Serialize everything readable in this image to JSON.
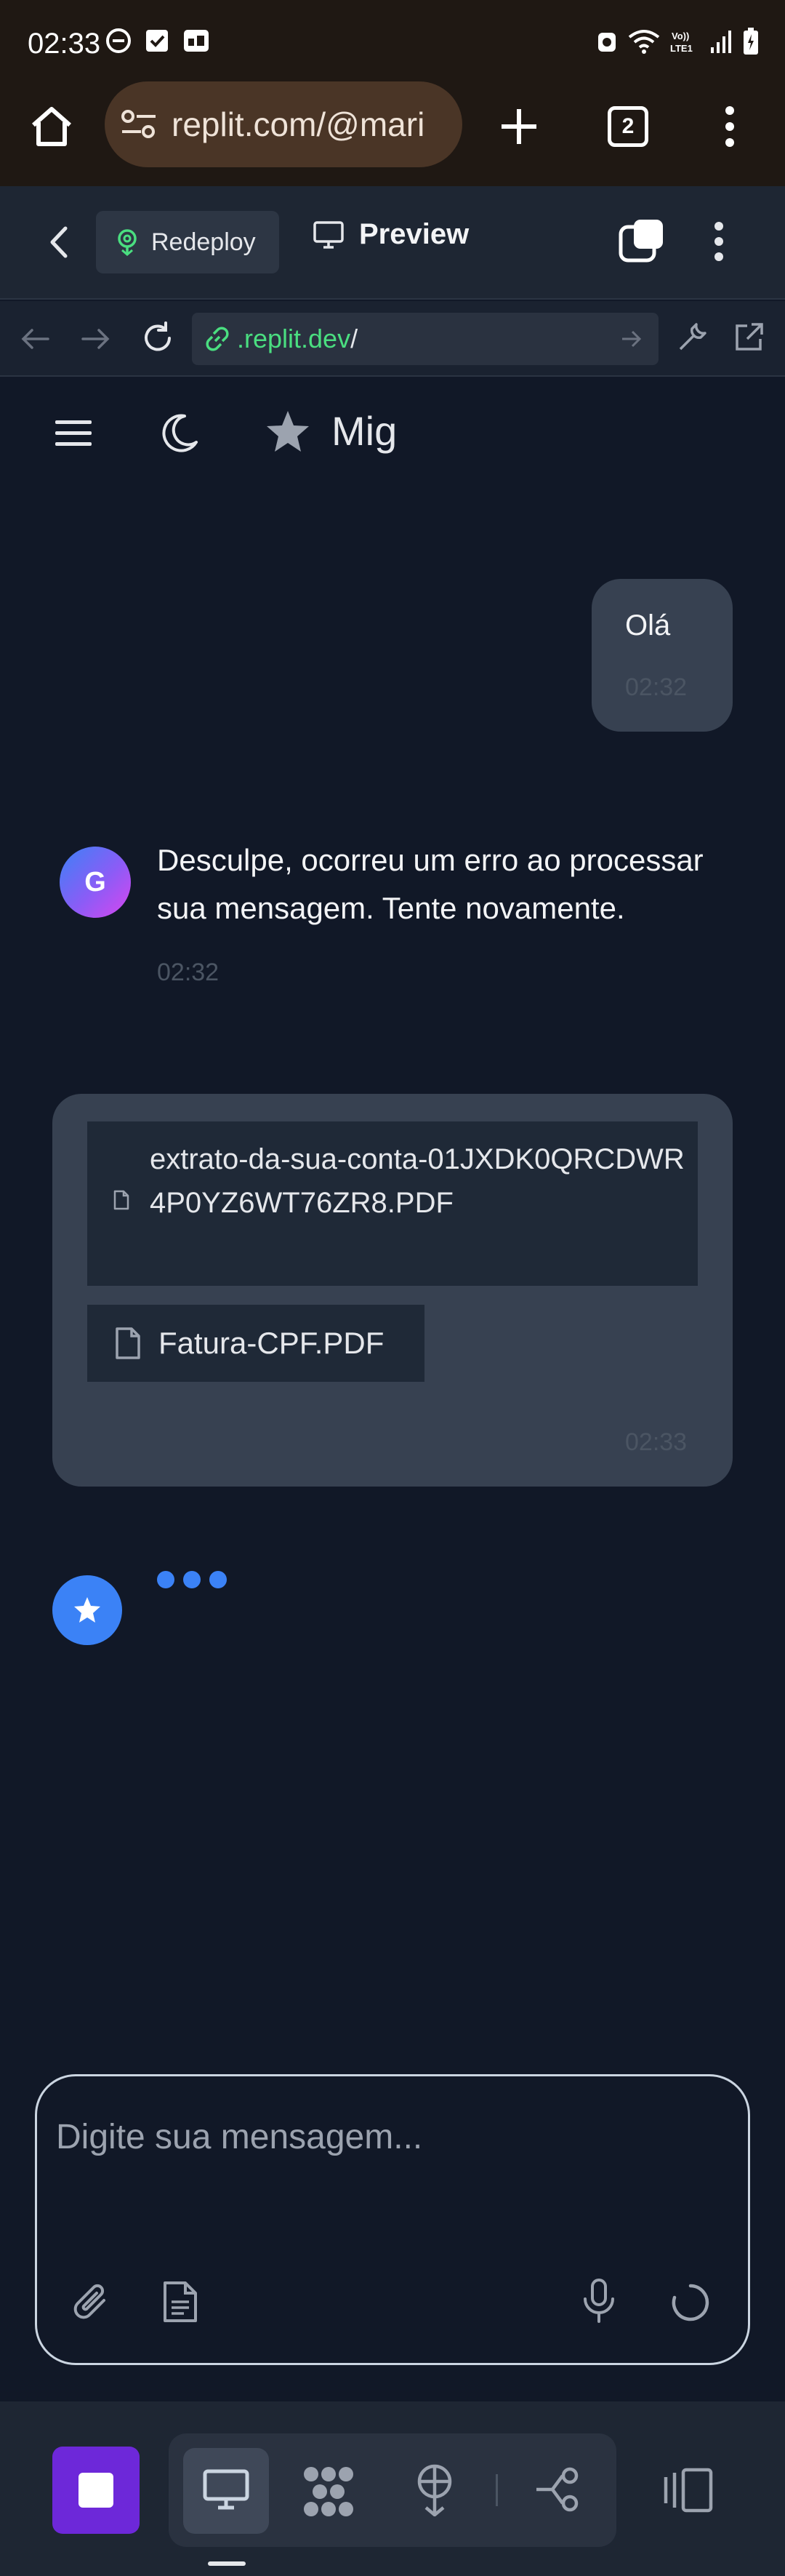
{
  "status_bar": {
    "time": "02:33"
  },
  "browser": {
    "url_display": "replit.com/@mari",
    "tab_count": "2"
  },
  "replit_bar": {
    "redeploy_label": "Redeploy",
    "preview_label": "Preview"
  },
  "address_bar": {
    "domain": ".replit.dev",
    "path": "/"
  },
  "app_header": {
    "title": "Mig"
  },
  "messages": [
    {
      "role": "user",
      "text": "Olá",
      "time": "02:32"
    },
    {
      "role": "assistant",
      "avatar_letter": "G",
      "text": "Desculpe, ocorreu um erro ao processar sua mensagem. Tente novamente.",
      "time": "02:32"
    },
    {
      "role": "user",
      "attachments": [
        "extrato-da-sua-conta-01JXDK0QRCDWR4P0YZ6WT76ZR8.PDF",
        "Fatura-CPF.PDF"
      ],
      "time": "02:33"
    }
  ],
  "composer": {
    "placeholder": "Digite sua mensagem..."
  },
  "colors": {
    "accent": "#3b82f6",
    "background": "#111827",
    "bubble": "#374151",
    "link_green": "#4ade80",
    "stop_purple": "#6d28d9"
  }
}
